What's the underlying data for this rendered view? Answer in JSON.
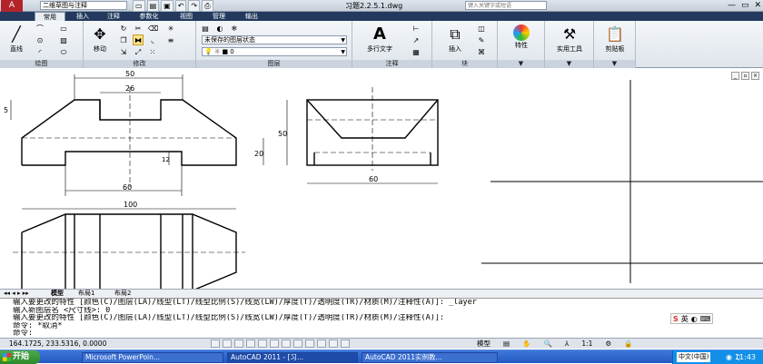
{
  "titlebar": {
    "app_button": "A",
    "workspace": "二维草图与注释",
    "title": "习题2.2.5.1.dwg",
    "search_placeholder": "键入关键字或短语",
    "window_controls": [
      "—",
      "▭",
      "✕"
    ]
  },
  "ribbon_tabs": [
    "常用",
    "插入",
    "注释",
    "参数化",
    "视图",
    "管理",
    "输出"
  ],
  "ribbon": {
    "draw_panel": {
      "title": "绘图",
      "line_label": "直线"
    },
    "modify_panel": {
      "title": "修改",
      "move_label": "移动"
    },
    "layers_panel": {
      "title": "图层",
      "layer_state": "未保存的图层状态",
      "current_layer": "0"
    },
    "annotation_panel": {
      "title": "注释",
      "mtext_label": "多行文字"
    },
    "block_panel": {
      "title": "块",
      "insert_label": "插入"
    },
    "properties_label": "特性",
    "utilities_label": "实用工具",
    "clipboard_label": "剪贴板"
  },
  "drawing": {
    "dimensions": {
      "front_top": "50",
      "front_inner": "26",
      "front_bottom": "60",
      "front_left": "5",
      "front_height": "12",
      "side_height": "50",
      "side_inner": "20",
      "side_width": "60",
      "top_width": "100"
    }
  },
  "layout_tabs": [
    "模型",
    "布局1",
    "布局2"
  ],
  "command_lines": [
    "输入要更改的特性 [颜色(C)/图层(LA)/线型(LT)/线型比例(S)/线宽(LW)/厚度(T)/透明度(TR)/材质(M)/注释性(A)]: _layer",
    "输入新图层名 <尺寸线>: 0",
    "输入要更改的特性 [颜色(C)/图层(LA)/线型(LT)/线型比例(S)/线宽(LW)/厚度(T)/透明度(TR)/材质(M)/注释性(A)]:",
    "命令: *取消*",
    "命令:"
  ],
  "ime": {
    "label": "英"
  },
  "status": {
    "coordinates": "164.1725, 233.5316, 0.0000",
    "model_label": "模型",
    "scale": "1:1"
  },
  "taskbar": {
    "start": "开始",
    "buttons": [
      "Microsoft PowerPoin...",
      "AutoCAD 2011 - [习...",
      "AutoCAD 2011实例教..."
    ],
    "ime": "中文(中国)",
    "clock": "11:43"
  }
}
